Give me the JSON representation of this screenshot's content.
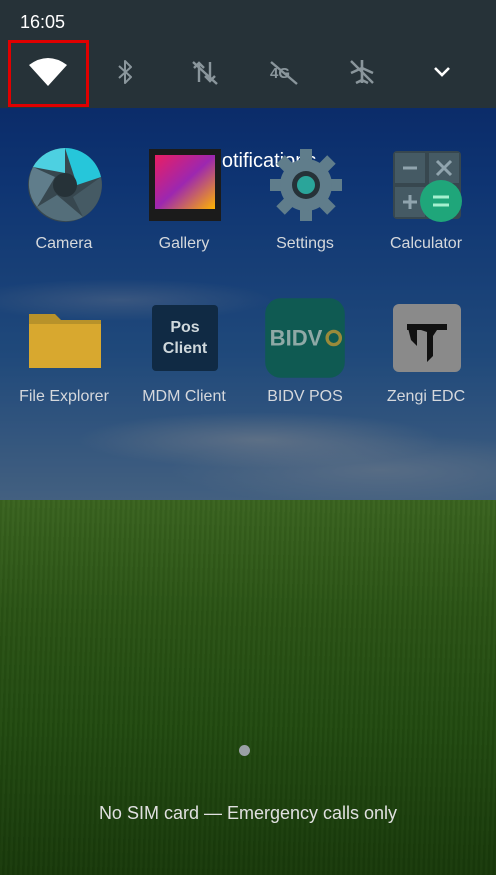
{
  "status_bar": {
    "time": "16:05"
  },
  "quick_settings": {
    "tiles": [
      {
        "name": "wifi",
        "icon": "wifi-icon"
      },
      {
        "name": "bluetooth",
        "icon": "bluetooth-icon"
      },
      {
        "name": "mobile-data",
        "icon": "data-off-icon"
      },
      {
        "name": "4g",
        "icon": "4g-off-icon"
      },
      {
        "name": "airplane-mode",
        "icon": "airplane-icon"
      },
      {
        "name": "expand",
        "icon": "chevron-down-icon"
      }
    ]
  },
  "notifications": {
    "empty_text": "No notifications"
  },
  "apps": [
    {
      "label": "Camera",
      "icon": "camera-icon"
    },
    {
      "label": "Gallery",
      "icon": "gallery-icon"
    },
    {
      "label": "Settings",
      "icon": "gear-icon"
    },
    {
      "label": "Calculator",
      "icon": "calculator-icon"
    },
    {
      "label": "File Explorer",
      "icon": "folder-icon"
    },
    {
      "label": "MDM Client",
      "icon": "pos-client-icon",
      "icon_text_1": "Pos",
      "icon_text_2": "Client"
    },
    {
      "label": "BIDV POS",
      "icon": "bidv-icon",
      "icon_text": "BIDV"
    },
    {
      "label": "Zengi EDC",
      "icon": "zengi-icon"
    }
  ],
  "footer": {
    "sim_status": "No SIM card — Emergency calls only"
  },
  "colors": {
    "panel": "#263238",
    "highlight": "#e00000"
  }
}
